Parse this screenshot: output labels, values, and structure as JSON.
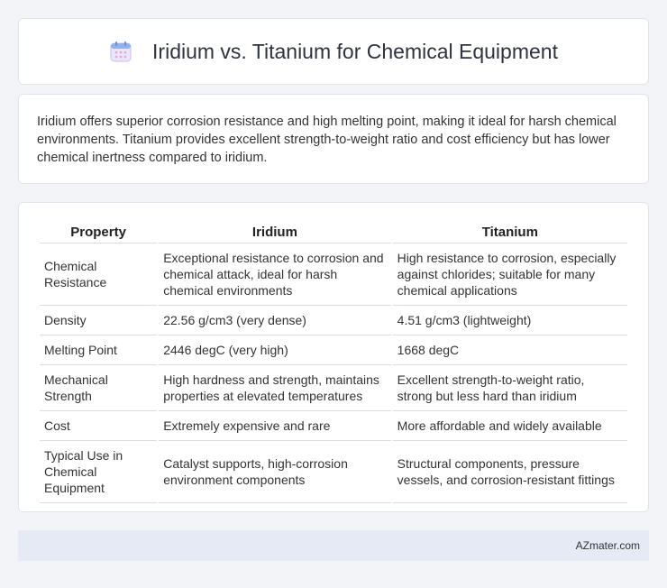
{
  "header": {
    "icon": "calendar-icon",
    "title": "Iridium vs. Titanium for Chemical Equipment"
  },
  "summary": {
    "text": "Iridium offers superior corrosion resistance and high melting point, making it ideal for harsh chemical environments. Titanium provides excellent strength-to-weight ratio and cost efficiency but has lower chemical inertness compared to iridium."
  },
  "table": {
    "headers": [
      "Property",
      "Iridium",
      "Titanium"
    ],
    "rows": [
      [
        "Chemical Resistance",
        "Exceptional resistance to corrosion and chemical attack, ideal for harsh chemical environments",
        "High resistance to corrosion, especially against chlorides; suitable for many chemical applications"
      ],
      [
        "Density",
        "22.56 g/cm3 (very dense)",
        "4.51 g/cm3 (lightweight)"
      ],
      [
        "Melting Point",
        "2446 degC (very high)",
        "1668 degC"
      ],
      [
        "Mechanical Strength",
        "High hardness and strength, maintains properties at elevated temperatures",
        "Excellent strength-to-weight ratio, strong but less hard than iridium"
      ],
      [
        "Cost",
        "Extremely expensive and rare",
        "More affordable and widely available"
      ],
      [
        "Typical Use in Chemical Equipment",
        "Catalyst supports, high-corrosion environment components",
        "Structural components, pressure vessels, and corrosion-resistant fittings"
      ]
    ]
  },
  "footer": {
    "brand": "AZmater.com"
  },
  "colors": {
    "background": "#f3f4f8",
    "card": "#ffffff",
    "footer": "#e6eaf5",
    "icon_accent": "#e9a6d6"
  }
}
